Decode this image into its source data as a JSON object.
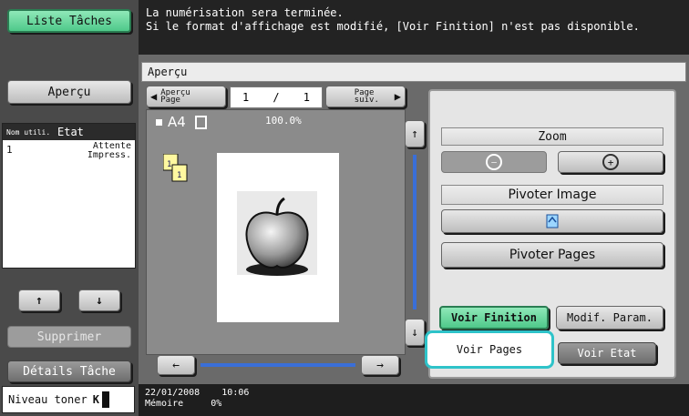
{
  "left": {
    "liste_taches": "Liste Tâches",
    "apercu": "Aperçu",
    "table": {
      "head_col1": "Nom utili.",
      "head_col2": "Etat",
      "rows": [
        {
          "col1": "1",
          "col2": "Attente Impress."
        }
      ]
    },
    "up_arrow": "↑",
    "down_arrow": "↓",
    "supprimer": "Supprimer",
    "details_tache": "Détails Tâche",
    "niveau_toner": "Niveau toner",
    "toner_k": "K"
  },
  "message": {
    "line1": "La numérisation sera terminée.",
    "line2": "Si le format d'affichage est modifié, [Voir Finition] n'est pas disponible."
  },
  "main": {
    "title": "Aperçu",
    "prev_page": "Aperçu Page",
    "page_current": "1",
    "page_sep": "/",
    "page_total": "1",
    "next_page": "Page suiv.",
    "paper_size": "A4",
    "zoom_percent": "100.0%",
    "scroll_left": "←",
    "scroll_right": "→",
    "scroll_up": "↑",
    "scroll_down": "↓"
  },
  "panel": {
    "zoom": "Zoom",
    "zoom_out": "−",
    "zoom_in": "+",
    "pivoter_image": "Pivoter Image",
    "pivoter_pages": "Pivoter Pages",
    "voir_finition": "Voir Finition",
    "modif_param": "Modif. Param.",
    "voir_pages": "Voir Pages",
    "voir_etat": "Voir Etat"
  },
  "status": {
    "datetime": "22/01/2008    10:06",
    "memoire_label": "Mémoire",
    "memoire_value": "0%"
  }
}
